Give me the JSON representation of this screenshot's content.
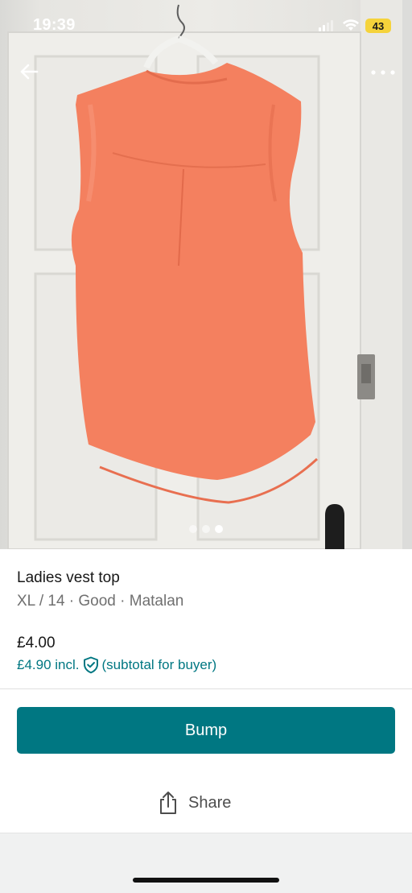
{
  "status_bar": {
    "time": "19:39",
    "battery_level": "43",
    "battery_color": "#f5d33b"
  },
  "nav": {
    "back_icon": "arrow-left-icon",
    "more_icon": "ellipsis-icon"
  },
  "gallery": {
    "photo_description_icon": "product-photo",
    "page_count": 3,
    "active_page": 3
  },
  "item": {
    "title": "Ladies vest top",
    "meta": "XL / 14 · Good · Matalan",
    "price": "£4.00",
    "price_incl": "£4.90 incl.",
    "protection_icon": "shield-check-icon",
    "subtotal_note": "(subtotal for buyer)"
  },
  "actions": {
    "bump_label": "Bump",
    "share_label": "Share",
    "share_icon": "share-icon"
  },
  "colors": {
    "accent": "#007782",
    "garment": "#f4805f"
  }
}
